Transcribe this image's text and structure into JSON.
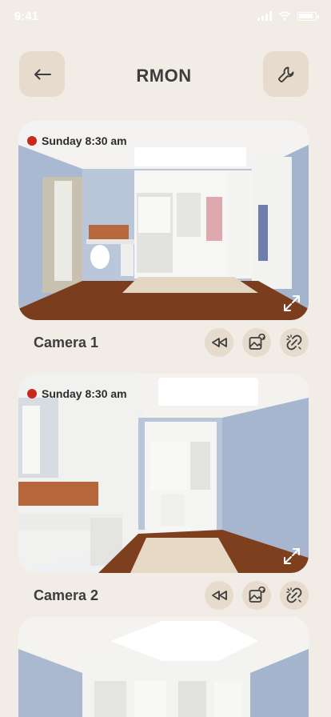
{
  "status_bar": {
    "time": "9:41"
  },
  "header": {
    "title": "RMON"
  },
  "cameras": [
    {
      "name": "Camera 1",
      "timestamp": "Sunday 8:30 am",
      "recording": true
    },
    {
      "name": "Camera 2",
      "timestamp": "Sunday 8:30 am",
      "recording": true
    },
    {
      "name": "",
      "timestamp": "",
      "recording": false
    }
  ],
  "colors": {
    "background": "#f1ece6",
    "button_bg": "#e6dbcd",
    "record_dot": "#c62a1f",
    "text": "#3d3d3d"
  },
  "icons": {
    "back": "arrow-left-icon",
    "settings": "wrench-icon",
    "rewind": "rewind-icon",
    "snapshot": "image-refresh-icon",
    "disconnect": "unlink-icon",
    "expand": "expand-icon"
  }
}
